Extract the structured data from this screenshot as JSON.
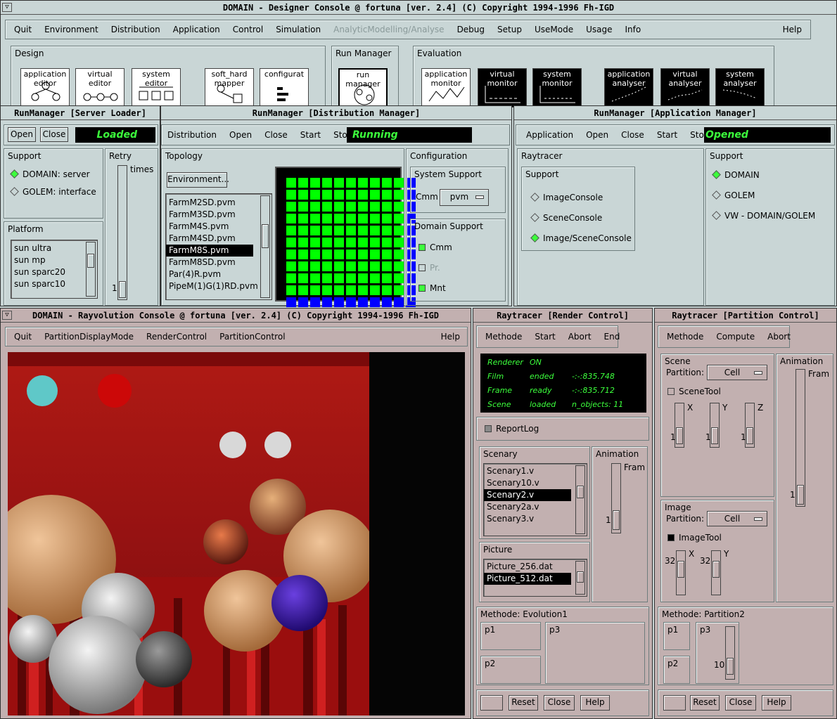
{
  "designer": {
    "title": "DOMAIN - Designer Console @ fortuna  [ver. 2.4]  (C) Copyright 1994-1996  Fh-IGD",
    "menu": [
      "Quit",
      "Environment",
      "Distribution",
      "Application",
      "Control",
      "Simulation",
      "AnalyticModelling/Analyse",
      "Debug",
      "Setup",
      "UseMode",
      "Usage",
      "Info"
    ],
    "help": "Help",
    "groups": {
      "design": "Design",
      "runmanager": "Run Manager",
      "evaluation": "Evaluation"
    },
    "icons": [
      "application editor",
      "virtual editor",
      "system editor",
      "soft_hard mapper",
      "configurat",
      "run manager",
      "application monitor",
      "virtual monitor",
      "system monitor",
      "application analyser",
      "virtual analyser",
      "system analyser"
    ]
  },
  "server_loader": {
    "title": "RunManager [Server Loader]",
    "open": "Open",
    "close": "Close",
    "status": "Loaded",
    "support_label": "Support",
    "options": [
      "DOMAIN: server",
      "GOLEM:  interface"
    ],
    "retry_label": "Retry",
    "times_label": "times",
    "retry_value": "1",
    "platform_label": "Platform",
    "platforms": [
      "sun ultra",
      "sun mp",
      "sun sparc20",
      "sun sparc10"
    ]
  },
  "dist_manager": {
    "title": "RunManager [Distribution Manager]",
    "menu": [
      "Distribution",
      "Open",
      "Close",
      "Start",
      "Stop"
    ],
    "status": "Running",
    "topology_label": "Topology",
    "env_button": "Environment...",
    "files": [
      "FarmM2SD.pvm",
      "FarmM3SD.pvm",
      "FarmM4S.pvm",
      "FarmM4SD.pvm",
      "FarmM8S.pvm",
      "FarmM8SD.pvm",
      "Par(4)R.pvm",
      "PipeM(1)G(1)RD.pvm"
    ],
    "selected_file": "FarmM8S.pvm",
    "config_label": "Configuration",
    "system_support_label": "System Support",
    "cmm_label": "Cmm",
    "cmm_value": "pvm",
    "domain_support_label": "Domain Support",
    "domain_options": [
      {
        "label": "Cmm",
        "on": true
      },
      {
        "label": "Pr.",
        "on": false
      },
      {
        "label": "Mnt",
        "on": true
      }
    ],
    "grid": {
      "rows": 11,
      "cols": 11,
      "main_color": "#00ff00",
      "edge_color": "#0000ff"
    }
  },
  "app_manager": {
    "title": "RunManager [Application Manager]",
    "menu": [
      "Application",
      "Open",
      "Close",
      "Start",
      "Stop"
    ],
    "status": "Opened",
    "raytracer_label": "Raytracer",
    "support_label": "Support",
    "ray_options": [
      "ImageConsole",
      "SceneConsole",
      "Image/SceneConsole"
    ],
    "support_options": [
      "DOMAIN",
      "GOLEM",
      "VW - DOMAIN/GOLEM"
    ]
  },
  "rayvolution": {
    "title": "DOMAIN - Rayvolution Console @ fortuna [ver. 2.4]  (C) Copyright 1994-1996  Fh-IGD",
    "menu": [
      "Quit",
      "PartitionDisplayMode",
      "RenderControl",
      "PartitionControl"
    ],
    "help": "Help"
  },
  "render_control": {
    "title": "Raytracer [Render Control]",
    "menu": [
      "Methode",
      "Start",
      "Abort",
      "End"
    ],
    "status_rows": [
      [
        "Renderer",
        "ON",
        ""
      ],
      [
        "Film",
        "ended",
        "-:-:835.748"
      ],
      [
        "Frame",
        "ready",
        "-:-:835.712"
      ],
      [
        "Scene",
        "loaded",
        "n_objects: 11"
      ]
    ],
    "reportlog": "ReportLog",
    "scenary_label": "Scenary",
    "scenaries": [
      "Scenary1.v",
      "Scenary10.v",
      "Scenary2.v",
      "Scenary2a.v",
      "Scenary3.v"
    ],
    "selected_scenary": "Scenary2.v",
    "animation_label": "Animation",
    "frame_label": "Fram",
    "anim_value": "1",
    "picture_label": "Picture",
    "pictures": [
      "Picture_256.dat",
      "Picture_512.dat"
    ],
    "selected_picture": "Picture_512.dat",
    "methode_label": "Methode: Evolution1",
    "params": [
      "p1",
      "p2",
      "p3"
    ],
    "buttons": [
      "Reset",
      "Close",
      "Help"
    ]
  },
  "partition_control": {
    "title": "Raytracer [Partition Control]",
    "menu": [
      "Methode",
      "Compute",
      "Abort"
    ],
    "scene_label": "Scene",
    "partition_label": "Partition:",
    "scene_partition": "Cell",
    "scenetool": "SceneTool",
    "axes": [
      "X",
      "Y",
      "Z"
    ],
    "axis_values": [
      "1",
      "1",
      "1"
    ],
    "animation_label": "Animation",
    "frame_label": "Fram",
    "anim_value": "1",
    "image_label": "Image",
    "image_partition": "Cell",
    "imagetool": "ImageTool",
    "image_axes": [
      "X",
      "Y"
    ],
    "image_values": [
      "32",
      "32"
    ],
    "methode_label": "Methode: Partition2",
    "params": [
      "p1",
      "p2",
      "p3"
    ],
    "p3_value": "10",
    "buttons": [
      "Reset",
      "Close",
      "Help"
    ]
  },
  "colors": {
    "designer_bg": "#c9d6d6",
    "raytracer_bg": "#c2b0b0",
    "status_text": "#3cff3c"
  }
}
